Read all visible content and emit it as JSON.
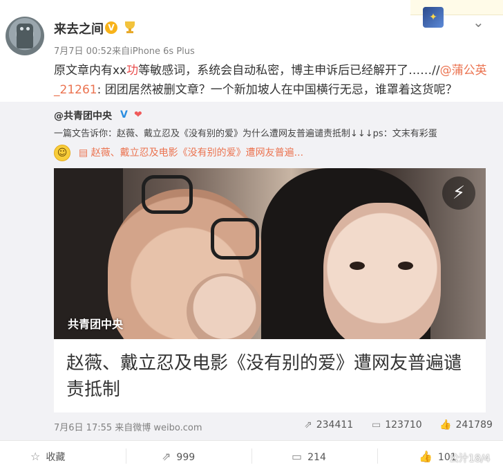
{
  "post": {
    "username": "来去之间",
    "verified_mark": "V",
    "meta": "7月7日 00:52来自iPhone 6s Plus",
    "text_part1": "原文章内有xx",
    "text_red": "功",
    "text_part2": "等敏感词，系统会自动私密，博主申诉后已经解开了……//",
    "mention": "@蒲公英_21261",
    "text_part3": ": 团团居然被删文章？一个新加坡人在中国横行无忌，谁罩着这货呢？"
  },
  "repost": {
    "user": "@共青团中央",
    "verified_mark": "V",
    "text": "一篇文告诉你：赵薇、戴立忍及《没有别的爱》为什么遭网友普遍谴责抵制↓↓↓ps：文末有彩蛋",
    "article_link": "▤ 赵薇、戴立忍及电影《没有别的爱》遭网友普遍...",
    "photo_watermark": "共青团中央",
    "article_title": "赵薇、戴立忍及电影《没有别的爱》遭网友普遍谴责抵制",
    "meta": "7月6日 17:55 来自微博 weibo.com",
    "reposts": "234411",
    "comments": "123710",
    "likes": "241789"
  },
  "actions": {
    "favorite": "收藏",
    "repost": "999",
    "comment": "214",
    "like": "101"
  },
  "corner_watermark": "公汁18/4",
  "icons": [
    "avatar",
    "v-badge-icon",
    "medal-icon",
    "chevron-down-icon",
    "smile-icon",
    "lightning-icon",
    "repost-icon",
    "comment-icon",
    "like-icon",
    "star-icon"
  ]
}
